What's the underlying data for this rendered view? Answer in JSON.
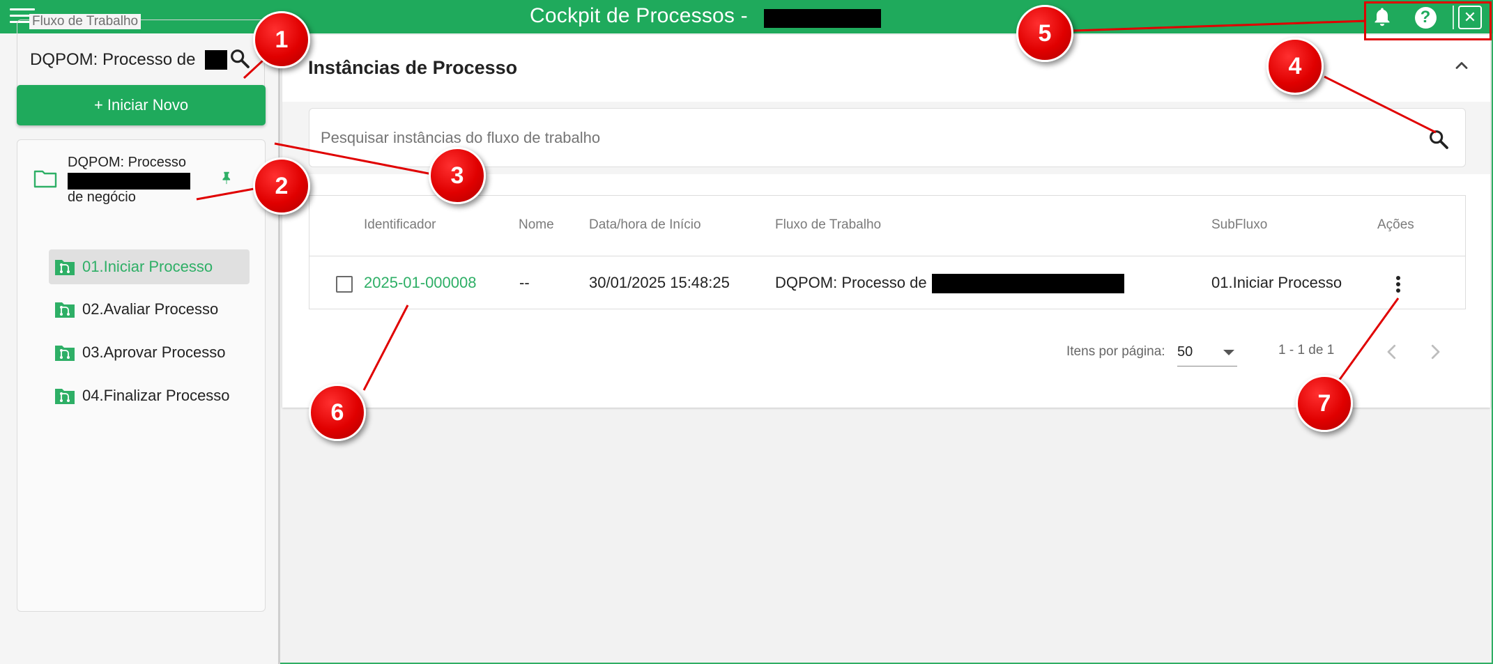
{
  "titlebar": {
    "title": "Cockpit de Processos -",
    "menu_icon": "hamburger-menu-icon",
    "bell_icon": "bell-icon",
    "help_icon": "question-icon",
    "help_glyph": "?",
    "close_icon": "close-icon",
    "close_glyph": "✕"
  },
  "sidebar": {
    "workflow_legend": "Fluxo de Trabalho",
    "workflow_value": "DQPOM: Processo de",
    "start_new_label": "+ Iniciar Novo",
    "tree_root": {
      "line1": "DQPOM: Processo",
      "line2": "de negócio"
    },
    "items": [
      {
        "label": "01.Iniciar Processo",
        "selected": true
      },
      {
        "label": "02.Avaliar Processo",
        "selected": false
      },
      {
        "label": "03.Aprovar Processo",
        "selected": false
      },
      {
        "label": "04.Finalizar Processo",
        "selected": false
      }
    ]
  },
  "main": {
    "section_title": "Instâncias de Processo",
    "search_placeholder": "Pesquisar instâncias do fluxo de trabalho",
    "table": {
      "headers": {
        "id": "Identificador",
        "name": "Nome",
        "start": "Data/hora de Início",
        "workflow": "Fluxo de Trabalho",
        "subflow": "SubFluxo",
        "actions": "Ações"
      },
      "rows": [
        {
          "id": "2025-01-000008",
          "name": "--",
          "start": "30/01/2025 15:48:25",
          "workflow": "DQPOM: Processo de",
          "subflow": "01.Iniciar Processo"
        }
      ]
    },
    "pagination": {
      "items_per_page_label": "Itens por página:",
      "items_per_page": "50",
      "range": "1 - 1 de 1"
    }
  },
  "annotations": [
    "1",
    "2",
    "3",
    "4",
    "5",
    "6",
    "7"
  ],
  "colors": {
    "brand_green": "#1faa5c",
    "link_green": "#2eaf66",
    "annotation_red": "#e00000"
  }
}
